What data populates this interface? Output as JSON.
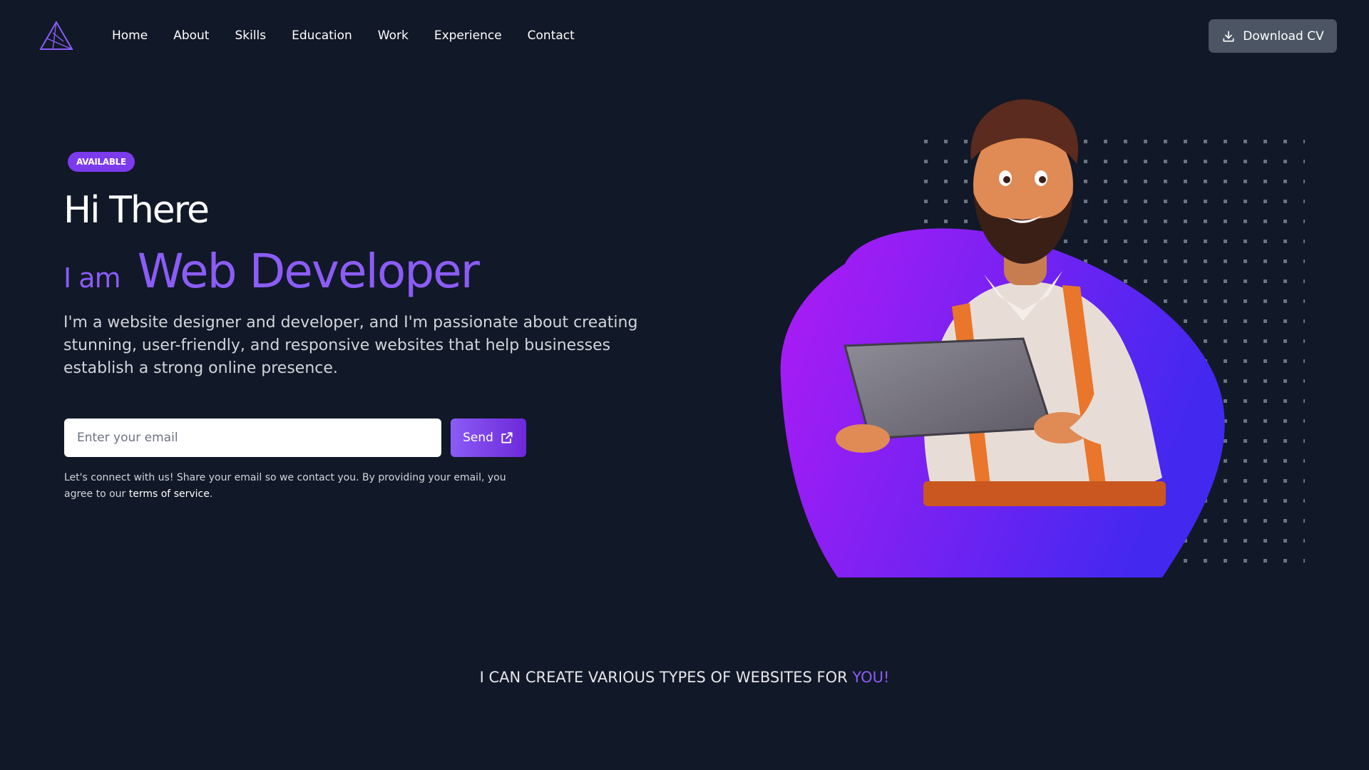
{
  "nav": {
    "logo_icon": "triangle-logo-icon",
    "links": [
      "Home",
      "About",
      "Skills",
      "Education",
      "Work",
      "Experience",
      "Contact"
    ],
    "cta_label": "Download CV",
    "cta_icon": "download-icon"
  },
  "hero": {
    "badge": "AVAILABLE",
    "greeting": "Hi There",
    "iam": "I am",
    "role": "Web Developer",
    "description": "I'm a website designer and developer, and I'm passionate about creating stunning, user-friendly, and responsive websites that help businesses establish a strong online presence.",
    "email_placeholder": "Enter your email",
    "send_label": "Send",
    "send_icon": "external-link-icon",
    "legal_text": "Let's connect with us! Share your email so we contact you. By providing your email, you agree to our",
    "legal_link": "terms of service",
    "legal_end": ".",
    "illustration": "developer-with-laptop-illustration"
  },
  "tagline": {
    "text": "I CAN CREATE VARIOUS TYPES OF WEBSITES FOR ",
    "highlight": "YOU!"
  },
  "colors": {
    "background": "#111827",
    "accent": "#8b5cf6",
    "badge": "#7c3aed",
    "cta_bg": "#4b5563",
    "blob_start": "#b01bf5",
    "blob_end": "#4328f0"
  }
}
